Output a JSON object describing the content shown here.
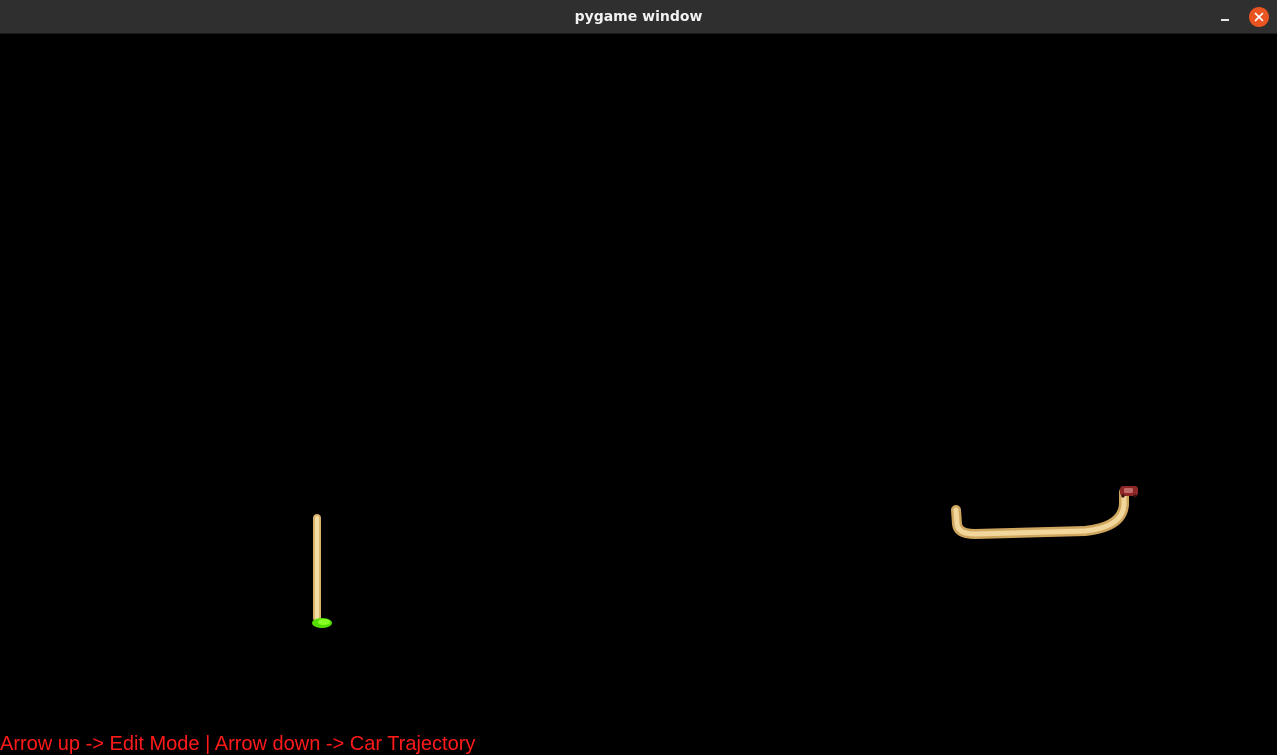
{
  "window": {
    "title": "pygame window"
  },
  "icons": {
    "minimize": "minimize-icon",
    "close": "close-icon"
  },
  "colors": {
    "track": "#e8c989",
    "start_marker": "#66ee11",
    "car": "#9b2a2a",
    "status_text": "#ff1a1a",
    "close_button": "#e95420"
  },
  "status": {
    "instructions": "Arrow up -> Edit Mode | Arrow down -> Car Trajectory"
  }
}
